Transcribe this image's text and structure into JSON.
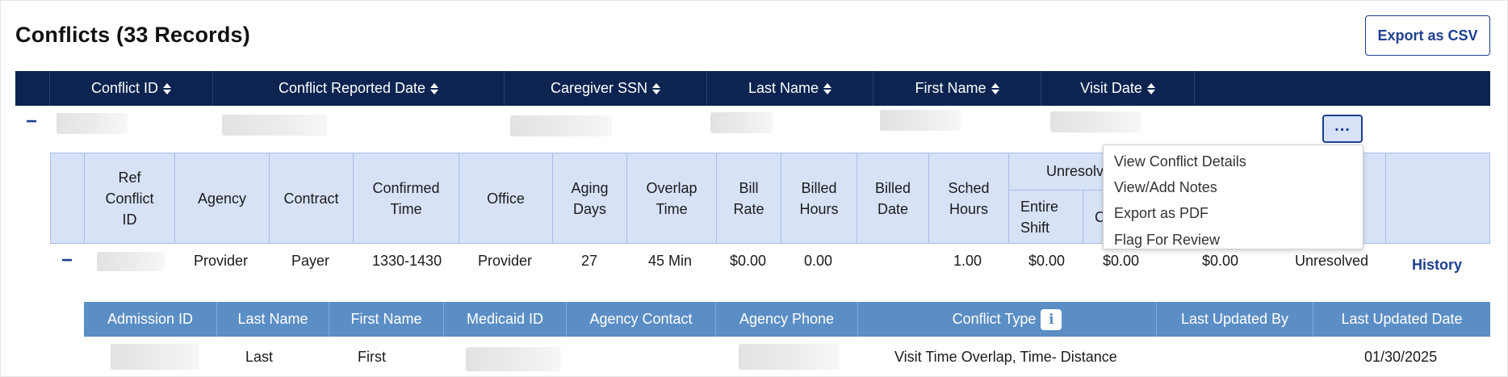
{
  "page": {
    "title": "Conflicts (33 Records)",
    "export_label": "Export as CSV"
  },
  "main_table": {
    "headers": [
      "Conflict ID",
      "Conflict Reported Date",
      "Caregiver SSN",
      "Last Name",
      "First Name",
      "Visit Date"
    ],
    "collapse_symbol": "−",
    "more_symbol": "..."
  },
  "sub_table": {
    "headers": {
      "ref_conflict_id": "Ref\nConflict\nID",
      "agency": "Agency",
      "contract": "Contract",
      "confirmed_time": "Confirmed\nTime",
      "office": "Office",
      "aging_days": "Aging\nDays",
      "overlap_time": "Overlap\nTime",
      "bill_rate": "Bill\nRate",
      "billed_hours": "Billed\nHours",
      "billed_date": "Billed\nDate",
      "sched_hours": "Sched\nHours",
      "unresolved_group": "Unresolved",
      "entire_shift": "Entire\nShift",
      "c_partial": "C"
    },
    "row": {
      "agency": "Provider",
      "contract": "Payer",
      "confirmed_time": "1330-1430",
      "office": "Provider",
      "aging_days": "27",
      "overlap_time": "45 Min",
      "bill_rate": "$0.00",
      "billed_hours": "0.00",
      "billed_date": "",
      "sched_hours": "1.00",
      "entire_shift": "$0.00",
      "second_amount": "$0.00",
      "third_amount": "$0.00",
      "status": "Unresolved",
      "history_label": "History"
    }
  },
  "menu": {
    "items": [
      "View Conflict Details",
      "View/Add Notes",
      "Export as PDF",
      "Flag For Review"
    ]
  },
  "detail_table": {
    "headers": [
      "Admission ID",
      "Last Name",
      "First Name",
      "Medicaid ID",
      "Agency Contact",
      "Agency Phone",
      "Conflict Type",
      "Last Updated By",
      "Last Updated Date"
    ],
    "info_icon_glyph": "i",
    "row": {
      "last_name": "Last",
      "first_name": "First",
      "conflict_type": "Visit Time Overlap, Time- Distance",
      "last_updated_by": "",
      "last_updated_date": "01/30/2025"
    }
  },
  "colors": {
    "navy_header": "#0d2451",
    "sub_header_bg": "#d7e2f7",
    "detail_header_bg": "#5b8ec5",
    "accent_blue": "#1d3f8f"
  }
}
